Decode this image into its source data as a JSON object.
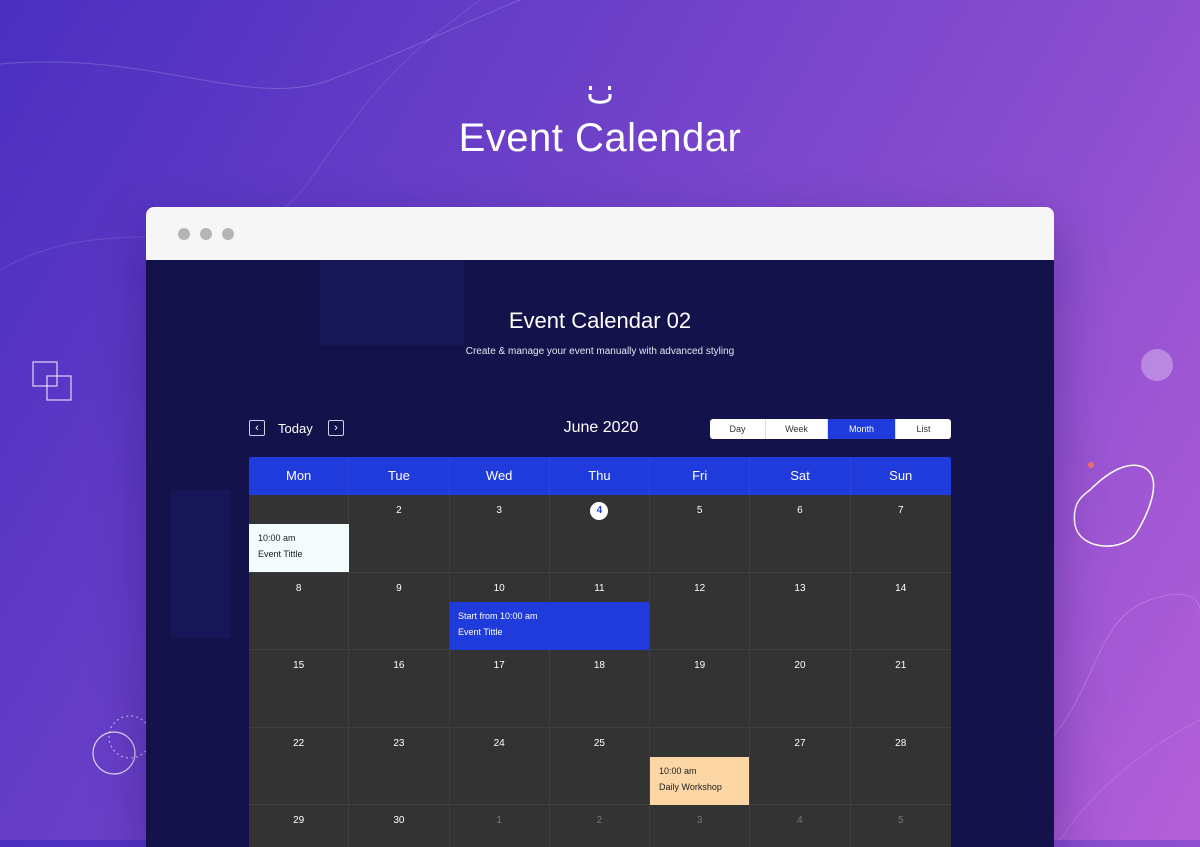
{
  "hero": {
    "title": "Event Calendar"
  },
  "calendar": {
    "title": "Event Calendar 02",
    "subtitle": "Create & manage your event manually with advanced styling",
    "today_label": "Today",
    "prev_icon": "chevron-left-icon",
    "next_icon": "chevron-right-icon",
    "month_label": "June 2020",
    "views": [
      {
        "label": "Day",
        "active": false
      },
      {
        "label": "Week",
        "active": false
      },
      {
        "label": "Month",
        "active": true
      },
      {
        "label": "List",
        "active": false
      }
    ],
    "weekdays": [
      "Mon",
      "Tue",
      "Wed",
      "Thu",
      "Fri",
      "Sat",
      "Sun"
    ],
    "weeks": [
      [
        "",
        "2",
        "3",
        "4",
        "5",
        "6",
        "7"
      ],
      [
        "8",
        "9",
        "10",
        "11",
        "12",
        "13",
        "14"
      ],
      [
        "15",
        "16",
        "17",
        "18",
        "19",
        "20",
        "21"
      ],
      [
        "22",
        "23",
        "24",
        "25",
        "",
        "27",
        "28"
      ],
      [
        "29",
        "30",
        "1",
        "2",
        "3",
        "4",
        "5"
      ]
    ],
    "today_day": "4",
    "events": [
      {
        "time": "10:00 am",
        "title": "Event Tittle",
        "color": "#f3fbfc",
        "text_color": "#222222"
      },
      {
        "time": "Start from 10:00 am",
        "title": "Event Tittle",
        "color": "#1f3bdb",
        "text_color": "#ffffff"
      },
      {
        "time": "10:00 am",
        "title": "Daily Workshop",
        "color": "#fdd6a6",
        "text_color": "#222222"
      }
    ]
  },
  "colors": {
    "accent": "#1f3bdb",
    "panel": "#13124a",
    "cell": "#333333"
  }
}
